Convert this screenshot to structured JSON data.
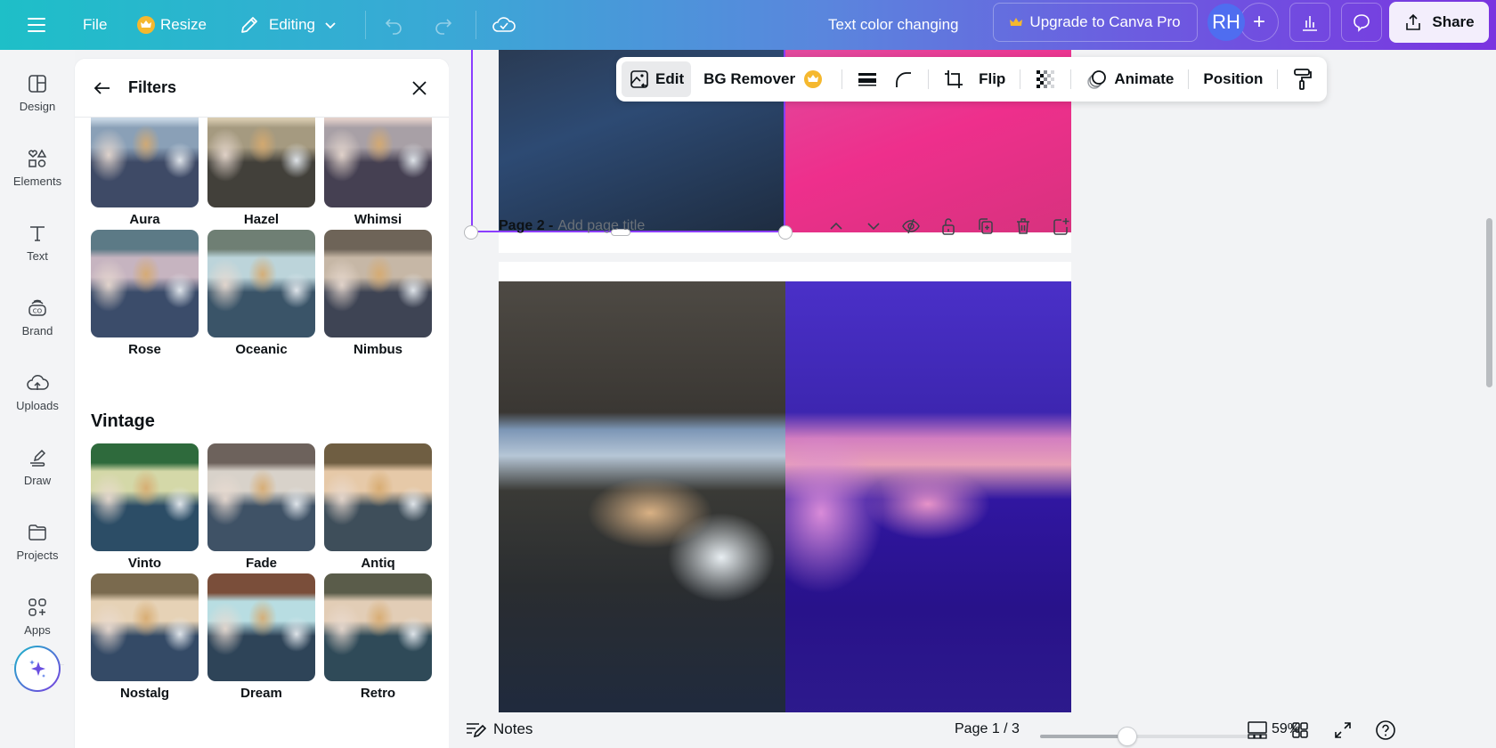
{
  "topbar": {
    "file": "File",
    "resize": "Resize",
    "editing": "Editing",
    "doc_title": "Text color changing",
    "upgrade": "Upgrade to Canva Pro",
    "avatar_initials": "RH",
    "share": "Share"
  },
  "rail": {
    "items": [
      {
        "label": "Design",
        "icon": "layout-icon"
      },
      {
        "label": "Elements",
        "icon": "shapes-icon"
      },
      {
        "label": "Text",
        "icon": "text-icon"
      },
      {
        "label": "Brand",
        "icon": "brand-icon"
      },
      {
        "label": "Uploads",
        "icon": "cloud-upload-icon"
      },
      {
        "label": "Draw",
        "icon": "pen-icon"
      },
      {
        "label": "Projects",
        "icon": "folder-icon"
      },
      {
        "label": "Apps",
        "icon": "apps-icon"
      }
    ]
  },
  "panel": {
    "title": "Filters",
    "filters": [
      {
        "label": "Aura",
        "tint": [
          "#c7d6e4",
          "#8aa0b7",
          "#3e4a66"
        ]
      },
      {
        "label": "Hazel",
        "tint": [
          "#d8cbb0",
          "#a59a80",
          "#42403a"
        ]
      },
      {
        "label": "Whimsi",
        "tint": [
          "#e2cfc9",
          "#a8a0a6",
          "#454052"
        ]
      },
      {
        "label": "Rose",
        "tint": [
          "#5c7a86",
          "#c6b4c0",
          "#3b4c6a"
        ]
      },
      {
        "label": "Oceanic",
        "tint": [
          "#6f7f74",
          "#bcd4da",
          "#3a5468"
        ]
      },
      {
        "label": "Nimbus",
        "tint": [
          "#6e6458",
          "#c6b7a6",
          "#3e4454"
        ]
      }
    ],
    "vintage_title": "Vintage",
    "vintage": [
      {
        "label": "Vinto",
        "tint": [
          "#2e6a3c",
          "#d4d8a8",
          "#2c4d66"
        ]
      },
      {
        "label": "Fade",
        "tint": [
          "#6d625c",
          "#d8d2ca",
          "#3f5266"
        ]
      },
      {
        "label": "Antiq",
        "tint": [
          "#6f5e42",
          "#e6c9a8",
          "#3e4e5a"
        ]
      },
      {
        "label": "Nostalg",
        "tint": [
          "#7a6a4e",
          "#e6d2b6",
          "#344a66"
        ]
      },
      {
        "label": "Dream",
        "tint": [
          "#7a4e3a",
          "#b8dde2",
          "#2e4458"
        ]
      },
      {
        "label": "Retro",
        "tint": [
          "#5a5c4a",
          "#e2cdb6",
          "#2f4a58"
        ]
      }
    ]
  },
  "context_toolbar": {
    "edit": "Edit",
    "bg_remover": "BG Remover",
    "flip": "Flip",
    "animate": "Animate",
    "position": "Position"
  },
  "page2": {
    "name": "Page 2 -",
    "title_placeholder": "Add page title"
  },
  "bottombar": {
    "notes": "Notes",
    "page_count": "Page 1 / 3",
    "zoom_percent": "59%",
    "zoom_slider_fraction": 0.42
  },
  "colors": {
    "accent": "#8b3dff",
    "crown": "#f5b82e"
  }
}
